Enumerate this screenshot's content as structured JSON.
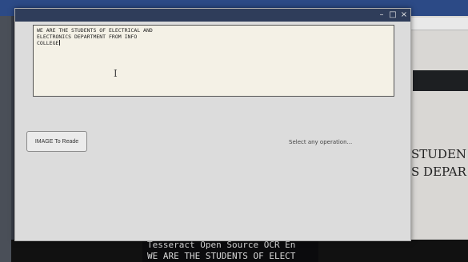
{
  "editor": {
    "lines": [
      "WE ARE THE STUDENTS OF ELECTRICAL AND",
      "ELECTRONICS DEPARTMENT FROM INFO",
      "COLLEGE"
    ]
  },
  "main": {
    "button_label": "IMAGE To Reade",
    "status": "Select any operation..."
  },
  "background": {
    "right_lines": [
      "STUDEN",
      "S DEPAR"
    ],
    "console_lines": [
      "Tesseract Open Source OCR En",
      "WE ARE THE STUDENTS OF ELECT"
    ]
  },
  "icons": {
    "minimize": "minimize-icon",
    "maximize": "maximize-icon",
    "close": "close-icon"
  },
  "colors": {
    "titlebar": "#2f3d5a",
    "textarea_bg": "#f4f1e6",
    "window_bg": "#dcdcdc"
  }
}
